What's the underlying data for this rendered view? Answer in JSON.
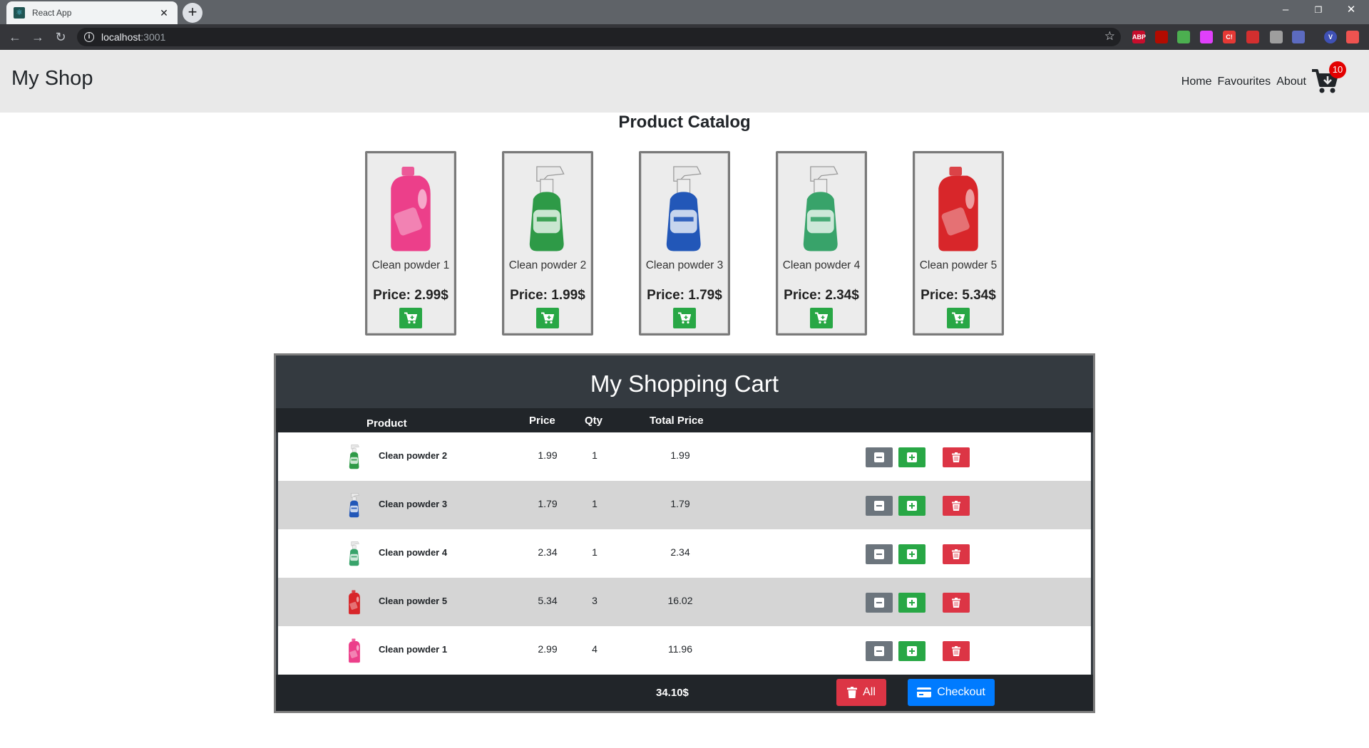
{
  "browser": {
    "tab_title": "React App",
    "url_host": "localhost",
    "url_port": ":3001",
    "extensions": [
      {
        "icon": "abp-icon",
        "label": "ABP",
        "color": "#c70d2c"
      },
      {
        "icon": "pdf-icon",
        "label": "",
        "color": "#b30b00"
      },
      {
        "icon": "ext-icon",
        "label": "",
        "color": "#4caf50"
      },
      {
        "icon": "ext-icon",
        "label": "",
        "color": "#e040fb"
      },
      {
        "icon": "ext-icon",
        "label": "C!",
        "color": "#e53935"
      },
      {
        "icon": "ext-icon",
        "label": "",
        "color": "#d32f2f"
      },
      {
        "icon": "ext-icon",
        "label": "",
        "color": "#9e9e9e"
      },
      {
        "icon": "ext-icon",
        "label": "",
        "color": "#5c6bc0"
      },
      {
        "icon": "profile-icon",
        "label": "V",
        "color": "#3f51b5"
      },
      {
        "icon": "ext-icon",
        "label": "",
        "color": "#ef5350"
      }
    ]
  },
  "header": {
    "brand": "My Shop",
    "nav": [
      "Home",
      "Favourites",
      "About"
    ],
    "cart_count": "10"
  },
  "catalog": {
    "title": "Product Catalog",
    "products": [
      {
        "name": "Clean powder 1",
        "price": "Price: 2.99$",
        "color": "#ec3f8a",
        "shape": "jug"
      },
      {
        "name": "Clean powder 2",
        "price": "Price: 1.99$",
        "color": "#2e9a47",
        "shape": "spray"
      },
      {
        "name": "Clean powder 3",
        "price": "Price: 1.79$",
        "color": "#2257b8",
        "shape": "spray"
      },
      {
        "name": "Clean powder 4",
        "price": "Price: 2.34$",
        "color": "#38a36a",
        "shape": "spray"
      },
      {
        "name": "Clean powder 5",
        "price": "Price: 5.34$",
        "color": "#d8262a",
        "shape": "jug"
      }
    ]
  },
  "cart": {
    "title": "My Shopping Cart",
    "columns": {
      "product": "Product",
      "price": "Price",
      "qty": "Qty",
      "total": "Total Price"
    },
    "rows": [
      {
        "name": "Clean powder 2",
        "price": "1.99",
        "qty": "1",
        "total": "1.99",
        "color": "#2e9a47"
      },
      {
        "name": "Clean powder 3",
        "price": "1.79",
        "qty": "1",
        "total": "1.79",
        "color": "#2257b8"
      },
      {
        "name": "Clean powder 4",
        "price": "2.34",
        "qty": "1",
        "total": "2.34",
        "color": "#38a36a"
      },
      {
        "name": "Clean powder 5",
        "price": "5.34",
        "qty": "3",
        "total": "16.02",
        "color": "#d8262a"
      },
      {
        "name": "Clean powder 1",
        "price": "2.99",
        "qty": "4",
        "total": "11.96",
        "color": "#ec3f8a"
      }
    ],
    "grand_total": "34.10$",
    "clear_all_label": "All",
    "checkout_label": "Checkout"
  },
  "colors": {
    "primary": "#007bff",
    "success": "#28a745",
    "danger": "#dc3545",
    "secondary": "#6c757d",
    "dark": "#343a40"
  }
}
